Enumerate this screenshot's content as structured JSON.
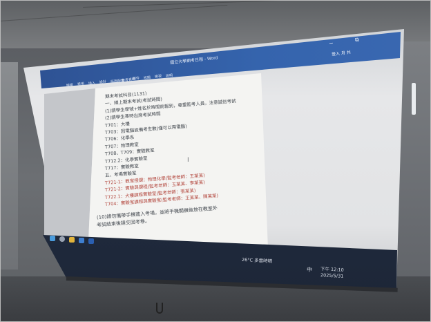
{
  "window": {
    "title": "國立大學期考日程 - Word",
    "min_label": "−",
    "restore_label": "⧉",
    "user_label": "登入  月 共"
  },
  "ribbon": [
    "檔案",
    "常用",
    "插入",
    "設計",
    "版面配置",
    "參考資料",
    "郵件",
    "校閱",
    "檢視",
    "說明"
  ],
  "document": {
    "lines": [
      {
        "text": "期末考試科目(1131)",
        "red": false
      },
      {
        "text": "一、線上期末考試(考試時間)",
        "red": false
      },
      {
        "text": "  (1)請學生學號+姓名於時間前報到，尊重監考人員，注意誠信考試",
        "red": false
      },
      {
        "text": "  (2)請學生準時出席考試時間",
        "red": false
      },
      {
        "text": "  T701：大樓",
        "red": false
      },
      {
        "text": "  T703：因電腦設備考生數(僅可以用電腦)",
        "red": false
      },
      {
        "text": "  T706：化學系",
        "red": false
      },
      {
        "text": "  T707：物理教室",
        "red": false
      },
      {
        "text": "  T708、T709：實驗教室",
        "red": false
      },
      {
        "text": "  T712.2：化學實驗室",
        "red": false
      },
      {
        "text": "  T717：實驗教室",
        "red": false
      },
      {
        "text": "  五、考場實驗室",
        "red": false
      },
      {
        "text": "  T721-1：教室授課：物理化學(監考老師：王某某)",
        "red": true
      },
      {
        "text": "  T721-2：實驗與課程(監考老師：王某某、李某某)",
        "red": true
      },
      {
        "text": "  T722.1：大樓課程實驗室(監考老師：張某某)",
        "red": true
      },
      {
        "text": "  T704：實驗室課程與實驗室(監考老師：王某某、陳某某)",
        "red": true
      },
      {
        "text": "(10)請勿攜帶手機進入考場，並將手機關機後放在教室外",
        "red": false
      },
      {
        "text": "  考試結束後請交回考卷。",
        "red": false
      }
    ],
    "cursor": "I"
  },
  "taskbar": {
    "weather": "26°C 多雲時晴",
    "ime": "中",
    "time": "下午 12:10",
    "date": "2025/5/31"
  }
}
